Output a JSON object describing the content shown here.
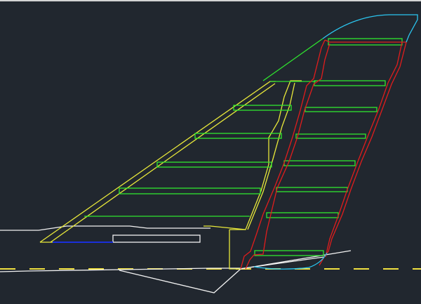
{
  "window": {
    "title": ""
  },
  "colors": {
    "background": "#21272f",
    "frame": "#d4d4d4",
    "rib": "#2fe62f",
    "spar_front": "#e8e83a",
    "spar_rear": "#e11d1d",
    "outline": "#f2f2f2",
    "tip_fairing": "#2bc6f0",
    "centerline_dash": "#f0e040",
    "fuselage_datum": "#1a2fd9"
  },
  "drawing": {
    "rib_count": 9,
    "layers": [
      "outline",
      "front-spar",
      "rear-spar",
      "ribs",
      "tip-fairing",
      "centerline",
      "fuselage-datum"
    ]
  }
}
